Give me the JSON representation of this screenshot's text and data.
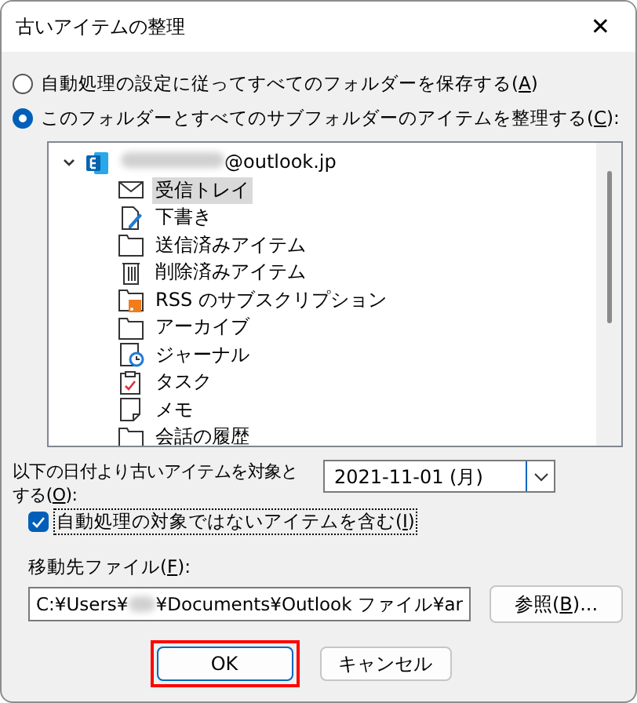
{
  "window": {
    "title": "古いアイテムの整理",
    "close": "✕"
  },
  "options": [
    {
      "label": "自動処理の設定に従ってすべてのフォルダーを保存する(",
      "access_key": "A",
      "label_end": ")",
      "selected": false
    },
    {
      "label": "このフォルダーとすべてのサブフォルダーのアイテムを整理する(",
      "access_key": "C",
      "label_end": "):",
      "selected": true
    }
  ],
  "tree": {
    "account": {
      "name": "@outlook.jp",
      "expanded": true,
      "redacted": true
    },
    "children": [
      {
        "label": "受信トレイ",
        "kind": "inbox",
        "selected": true
      },
      {
        "label": "下書き",
        "kind": "drafts",
        "selected": false
      },
      {
        "label": "送信済みアイテム",
        "kind": "folder",
        "selected": false
      },
      {
        "label": "削除済みアイテム",
        "kind": "trash",
        "selected": false
      },
      {
        "label": "RSS のサブスクリプション",
        "kind": "rss",
        "selected": false
      },
      {
        "label": "アーカイブ",
        "kind": "folder",
        "selected": false
      },
      {
        "label": "ジャーナル",
        "kind": "journal",
        "selected": false
      },
      {
        "label": "タスク",
        "kind": "task",
        "selected": false
      },
      {
        "label": "メモ",
        "kind": "note",
        "selected": false
      },
      {
        "label": "会話の履歴",
        "kind": "folder",
        "selected": false
      }
    ]
  },
  "date": {
    "label": "以下の日付より古いアイテムを対象とする(",
    "access_key": "O",
    "label_end": "):",
    "value": "2021-11-01 (月)"
  },
  "include": {
    "label": "自動処理の対象ではないアイテムを含む(",
    "access_key": "I",
    "label_end": ")",
    "checked": true
  },
  "target": {
    "label": "移動先ファイル(",
    "access_key": "F",
    "label_end": "):",
    "value_start": "C:¥Users¥",
    "value_end": "¥Documents¥Outlook ファイル¥ar",
    "browse": {
      "label": "参照(",
      "access_key": "B",
      "label_end": ")..."
    }
  },
  "buttons": [
    {
      "label": "OK",
      "highlighted": true
    },
    {
      "label": "キャンセル",
      "highlighted": false
    }
  ]
}
